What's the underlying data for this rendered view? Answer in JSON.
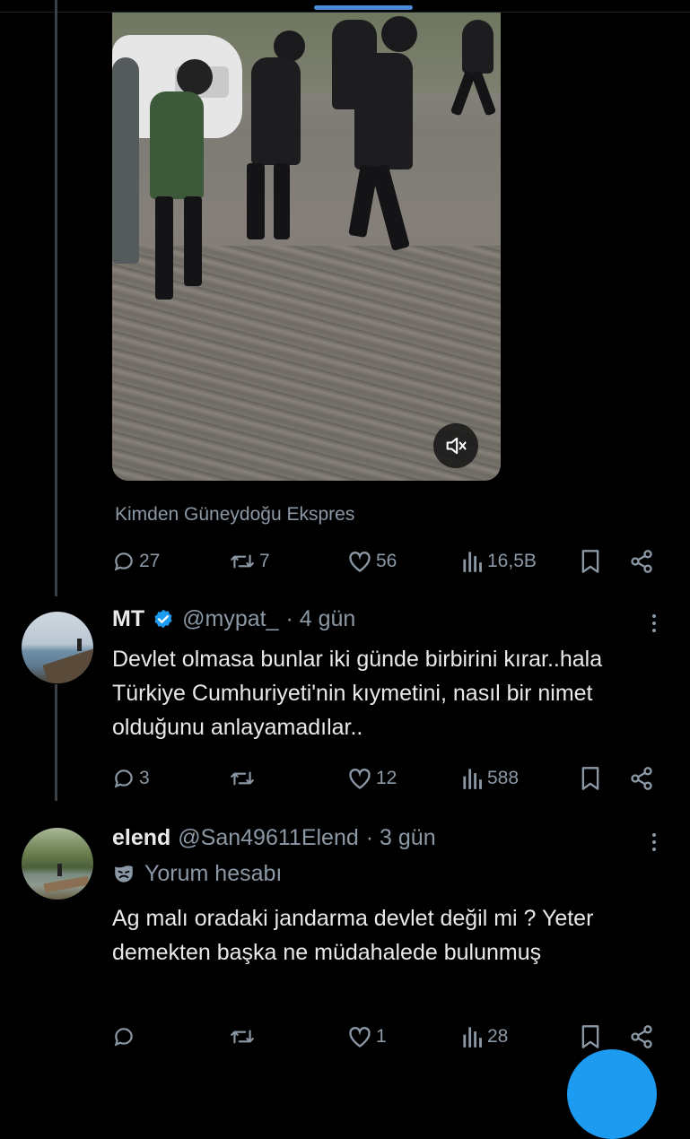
{
  "main_tweet": {
    "source_label": "Kimden Güneydoğu Ekspres",
    "stats": {
      "replies": "27",
      "retweets": "7",
      "likes": "56",
      "views": "16,5B"
    }
  },
  "replies": [
    {
      "name": "MT",
      "verified": true,
      "handle": "@mypat_",
      "time": "· 4 gün",
      "text": "Devlet olmasa bunlar iki günde birbirini kırar..hala Türkiye Cumhuriyeti'nin kıymetini, nasıl bir nimet olduğunu anlayamadılar..",
      "stats": {
        "replies": "3",
        "retweets": "",
        "likes": "12",
        "views": "588"
      }
    },
    {
      "name": "elend",
      "verified": false,
      "handle": "@San49611Elend",
      "time": "· 3 gün",
      "account_label": "Yorum hesabı",
      "text": "Ag malı oradaki jandarma devlet değil mi ? Yeter demekten başka ne müdahalede bulunmuş",
      "stats": {
        "replies": "",
        "retweets": "",
        "likes": "1",
        "views": "28"
      }
    }
  ],
  "colors": {
    "background": "#000000",
    "text": "#e7e9ea",
    "muted": "#8b98a5",
    "accent": "#1d9bf0"
  }
}
